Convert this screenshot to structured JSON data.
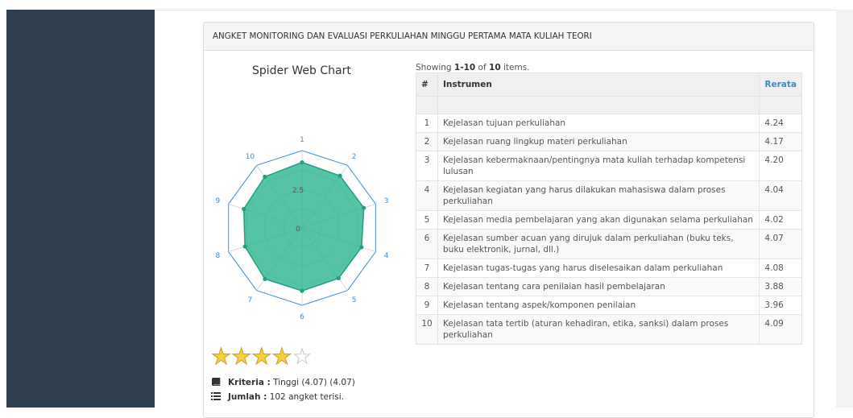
{
  "panel": {
    "title": "ANGKET MONITORING DAN EVALUASI PERKULIAHAN MINGGU PERTAMA MATA KULIAH TEORI"
  },
  "chart_data": {
    "type": "radar",
    "title": "Spider Web Chart",
    "categories": [
      "1",
      "2",
      "3",
      "4",
      "5",
      "6",
      "7",
      "8",
      "9",
      "10"
    ],
    "values": [
      4.24,
      4.17,
      4.2,
      4.04,
      4.02,
      4.07,
      4.08,
      3.88,
      3.96,
      4.09
    ],
    "rlim": [
      0,
      5
    ],
    "ticks": [
      "0",
      "2.5"
    ],
    "colors": {
      "fill": "#2ab48f",
      "stroke": "#21a080",
      "grid": "#3b8fd8"
    }
  },
  "rating": {
    "filled": 4,
    "total": 5
  },
  "info": {
    "kriteria_label": "Kriteria :",
    "kriteria_value": "Tinggi (4.07) (4.07)",
    "jumlah_label": "Jumlah :",
    "jumlah_value": "102 angket terisi."
  },
  "summary": {
    "prefix": "Showing",
    "range": "1-10",
    "of": "of",
    "total": "10",
    "suffix": "items."
  },
  "table": {
    "headers": {
      "num": "#",
      "instrument": "Instrumen",
      "avg": "Rerata"
    },
    "rows": [
      {
        "no": "1",
        "instrumen": "Kejelasan tujuan perkuliahan",
        "rerata": "4.24"
      },
      {
        "no": "2",
        "instrumen": "Kejelasan ruang lingkup materi perkuliahan",
        "rerata": "4.17"
      },
      {
        "no": "3",
        "instrumen": "Kejelasan kebermaknaan/pentingnya mata kuliah terhadap kompetensi lulusan",
        "rerata": "4.20"
      },
      {
        "no": "4",
        "instrumen": "Kejelasan kegiatan yang harus dilakukan mahasiswa dalam proses perkuliahan",
        "rerata": "4.04"
      },
      {
        "no": "5",
        "instrumen": "Kejelasan media pembelajaran yang akan digunakan selama perkuliahan",
        "rerata": "4.02"
      },
      {
        "no": "6",
        "instrumen": "Kejelasan sumber acuan yang dirujuk dalam perkuliahan (buku teks, buku elektronik, jurnal, dll.)",
        "rerata": "4.07"
      },
      {
        "no": "7",
        "instrumen": "Kejelasan tugas-tugas yang harus diselesaikan dalam perkuliahan",
        "rerata": "4.08"
      },
      {
        "no": "8",
        "instrumen": "Kejelasan tentang cara penilaian hasil pembelajaran",
        "rerata": "3.88"
      },
      {
        "no": "9",
        "instrumen": "Kejelasan tentang aspek/komponen penilaian",
        "rerata": "3.96"
      },
      {
        "no": "10",
        "instrumen": "Kejelasan tata tertib (aturan kehadiran, etika, sanksi) dalam proses perkuliahan",
        "rerata": "4.09"
      }
    ]
  }
}
